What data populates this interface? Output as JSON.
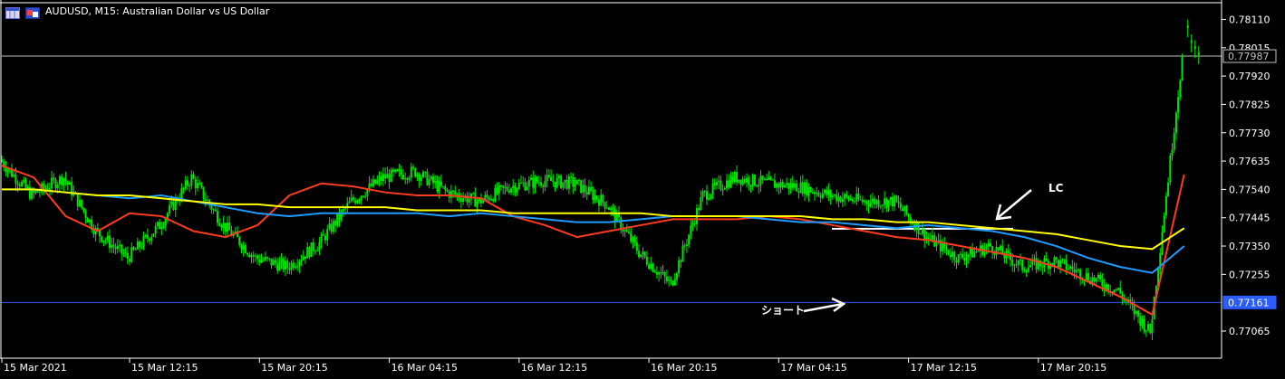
{
  "header": {
    "symbol": "AUDUSD",
    "timeframe": "M15",
    "description": "Australian Dollar vs US Dollar",
    "title": "AUDUSD, M15:  Australian Dollar vs US Dollar"
  },
  "icons": [
    "chart-window-icon",
    "tile-window-icon"
  ],
  "colors": {
    "background": "#000000",
    "candle": "#00e600",
    "ma_fast": "#ff3b1f",
    "ma_mid": "#1e9bff",
    "ma_slow": "#ffff00",
    "hline_blue": "#2a5cff",
    "hline_white": "#ffffff",
    "axis": "#ffffff"
  },
  "annotations": {
    "short_label": "ショート",
    "lc_label": "LC"
  },
  "chart_data": {
    "type": "line",
    "title": "AUDUSD, M15:  Australian Dollar vs US Dollar",
    "ylim": [
      0.7698,
      0.7816
    ],
    "y_ticks": [
      "0.78110",
      "0.78015",
      "0.77920",
      "0.77825",
      "0.77730",
      "0.77635",
      "0.77540",
      "0.77445",
      "0.77350",
      "0.77255",
      "0.77065"
    ],
    "x_ticks": [
      "15 Mar 2021",
      "15 Mar 12:15",
      "15 Mar 20:15",
      "16 Mar 04:15",
      "16 Mar 12:15",
      "16 Mar 20:15",
      "17 Mar 04:15",
      "17 Mar 12:15",
      "17 Mar 20:15"
    ],
    "grid": false,
    "price_markers": [
      {
        "label": "0.77987",
        "value": 0.77987,
        "style": "current-price"
      },
      {
        "label": "0.77161",
        "value": 0.77161,
        "style": "horizontal-line"
      }
    ],
    "horizontal_lines": [
      {
        "name": "",
        "value": 0.77161,
        "color": "#2a5cff"
      },
      {
        "name": "",
        "value": 0.77987,
        "color": "#c0c0c0"
      },
      {
        "name": "",
        "value": 0.77408,
        "color": "#ffffff",
        "x_start": "17 Mar 12:15",
        "x_end": "17 Mar 20:15"
      }
    ],
    "x": [
      0,
      8,
      16,
      24,
      32,
      40,
      48,
      56,
      64,
      72,
      80,
      88,
      96,
      104,
      112,
      120,
      128,
      136,
      144,
      152,
      160,
      168,
      176,
      184,
      192,
      200,
      208,
      216,
      224,
      232,
      240,
      248,
      256,
      264,
      272,
      280,
      288,
      296
    ],
    "x_unit": "15-minute bars since 15 Mar 2021 00:00",
    "series": [
      {
        "name": "",
        "role": "price",
        "values": [
          0.7764,
          0.7752,
          0.7758,
          0.774,
          0.7731,
          0.7742,
          0.7758,
          0.7742,
          0.7731,
          0.7728,
          0.7736,
          0.775,
          0.7758,
          0.776,
          0.7753,
          0.775,
          0.7755,
          0.7757,
          0.7756,
          0.7749,
          0.7733,
          0.7722,
          0.7752,
          0.7758,
          0.7756,
          0.7755,
          0.7752,
          0.775,
          0.775,
          0.7738,
          0.7731,
          0.7735,
          0.7728,
          0.773,
          0.7725,
          0.772,
          0.7706,
          0.7798
        ]
      },
      {
        "name": "",
        "role": "ma-fast",
        "values": [
          0.7762,
          0.7758,
          0.7745,
          0.774,
          0.7746,
          0.7745,
          0.774,
          0.7738,
          0.7742,
          0.7752,
          0.7756,
          0.7755,
          0.7753,
          0.7752,
          0.7752,
          0.7751,
          0.7745,
          0.7742,
          0.7738,
          0.774,
          0.7742,
          0.7744,
          0.7744,
          0.7744,
          0.7745,
          0.7744,
          0.7742,
          0.774,
          0.7738,
          0.7737,
          0.7735,
          0.7733,
          0.7731,
          0.7728,
          0.7723,
          0.7718,
          0.7712,
          0.7759
        ]
      },
      {
        "name": "",
        "role": "ma-mid",
        "values": [
          0.7754,
          0.7754,
          0.7753,
          0.7752,
          0.7751,
          0.7752,
          0.775,
          0.7748,
          0.7746,
          0.7745,
          0.7746,
          0.7746,
          0.7746,
          0.7746,
          0.7745,
          0.7746,
          0.7745,
          0.7744,
          0.7743,
          0.7743,
          0.7744,
          0.7745,
          0.7745,
          0.7745,
          0.7744,
          0.7743,
          0.7743,
          0.7742,
          0.7741,
          0.7742,
          0.7741,
          0.774,
          0.7738,
          0.7735,
          0.7731,
          0.7728,
          0.7726,
          0.7735
        ]
      },
      {
        "name": "",
        "role": "ma-slow",
        "values": [
          0.7754,
          0.7754,
          0.7753,
          0.7752,
          0.7752,
          0.7751,
          0.775,
          0.7749,
          0.7749,
          0.7748,
          0.7748,
          0.7748,
          0.7748,
          0.7747,
          0.7747,
          0.7747,
          0.7746,
          0.7746,
          0.7746,
          0.7746,
          0.7746,
          0.7745,
          0.7745,
          0.7745,
          0.7745,
          0.7745,
          0.7744,
          0.7744,
          0.7743,
          0.7743,
          0.7742,
          0.7741,
          0.774,
          0.7739,
          0.7737,
          0.7735,
          0.7734,
          0.7741
        ]
      }
    ]
  }
}
